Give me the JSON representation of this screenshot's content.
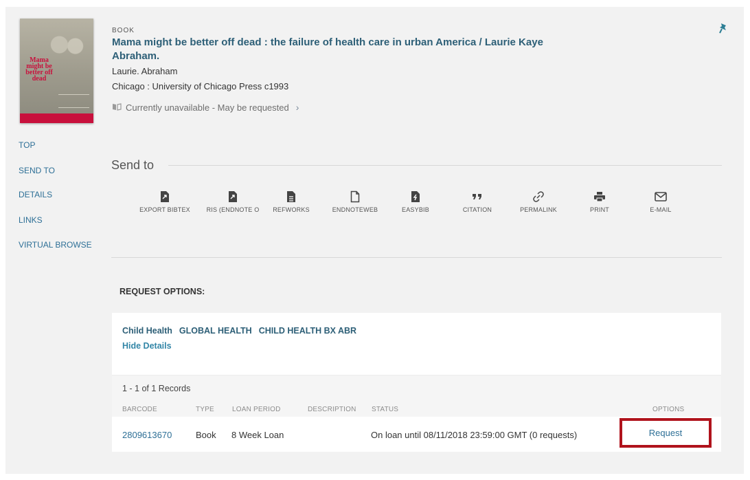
{
  "record": {
    "type": "BOOK",
    "title": "Mama might be better off dead : the failure of health care in urban America / Laurie Kaye Abraham.",
    "author": "Laurie. Abraham",
    "publisher": "Chicago : University of Chicago Press c1993",
    "availability": "Currently unavailable - May be requested",
    "cover_title": "Mama might be better off dead"
  },
  "leftnav": [
    "TOP",
    "SEND TO",
    "DETAILS",
    "LINKS",
    "VIRTUAL BROWSE"
  ],
  "sendto": {
    "title": "Send to",
    "actions": [
      {
        "label": "EXPORT BIBTEX",
        "icon": "export-bibtex-icon"
      },
      {
        "label": "RIS (ENDNOTE O",
        "icon": "ris-icon"
      },
      {
        "label": "REFWORKS",
        "icon": "refworks-icon"
      },
      {
        "label": "ENDNOTEWEB",
        "icon": "endnoteweb-icon"
      },
      {
        "label": "EASYBIB",
        "icon": "easybib-icon"
      },
      {
        "label": "CITATION",
        "icon": "citation-icon"
      },
      {
        "label": "PERMALINK",
        "icon": "link-icon"
      },
      {
        "label": "PRINT",
        "icon": "print-icon"
      },
      {
        "label": "E-MAIL",
        "icon": "email-icon"
      }
    ]
  },
  "request": {
    "title": "REQUEST OPTIONS:",
    "location": [
      "Child Health",
      "GLOBAL HEALTH",
      "CHILD HEALTH BX ABR"
    ],
    "hide_details": "Hide Details",
    "records_count": "1 - 1 of 1 Records",
    "columns": [
      "BARCODE",
      "TYPE",
      "LOAN PERIOD",
      "DESCRIPTION",
      "STATUS",
      "OPTIONS"
    ],
    "row": {
      "barcode": "2809613670",
      "type": "Book",
      "loan_period": "8 Week Loan",
      "description": "",
      "status": "On loan until 08/11/2018 23:59:00 GMT (0 requests)",
      "option": "Request"
    }
  },
  "colors": {
    "link": "#2d6f96",
    "title": "#2d5f77",
    "highlight": "#b0131c"
  }
}
